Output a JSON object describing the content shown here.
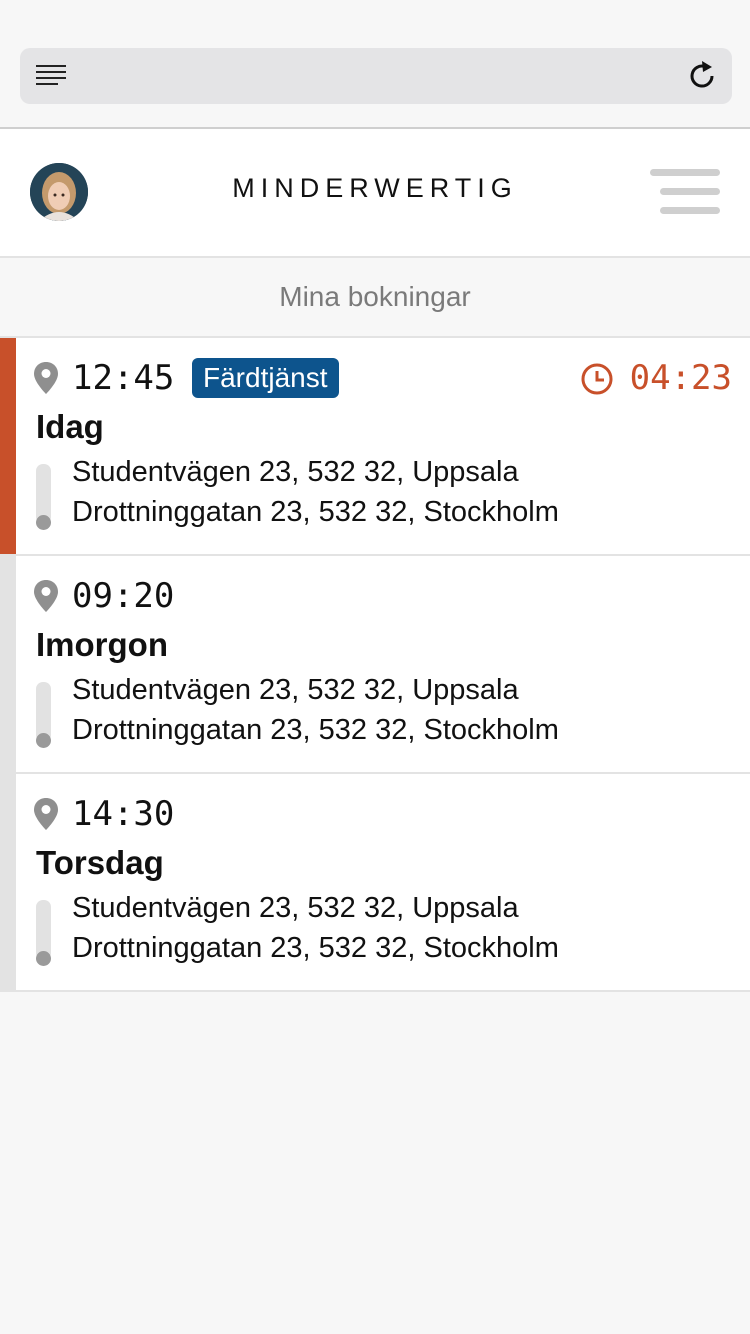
{
  "browser": {
    "reader_icon": "reader-lines-icon",
    "reload_icon": "reload-icon"
  },
  "header": {
    "brand": "MINDERWERTIG",
    "avatar": "avatar",
    "menu_icon": "hamburger-icon"
  },
  "section": {
    "title": "Mina bokningar"
  },
  "bookings": [
    {
      "time": "12:45",
      "badge": "Färdtjänst",
      "countdown": "04:23",
      "day": "Idag",
      "from": "Studentvägen 23, 532 32, Uppsala",
      "to": "Drottninggatan 23, 532 32, Stockholm",
      "active": true
    },
    {
      "time": "09:20",
      "day": "Imorgon",
      "from": "Studentvägen 23, 532 32, Uppsala",
      "to": "Drottninggatan 23, 532 32, Stockholm",
      "active": false
    },
    {
      "time": "14:30",
      "day": "Torsdag",
      "from": "Studentvägen 23, 532 32, Uppsala",
      "to": "Drottninggatan 23, 532 32, Stockholm",
      "active": false
    }
  ],
  "colors": {
    "accent": "#c8502a",
    "badge": "#0d548d",
    "stripe_inactive": "#e3e3e3"
  }
}
